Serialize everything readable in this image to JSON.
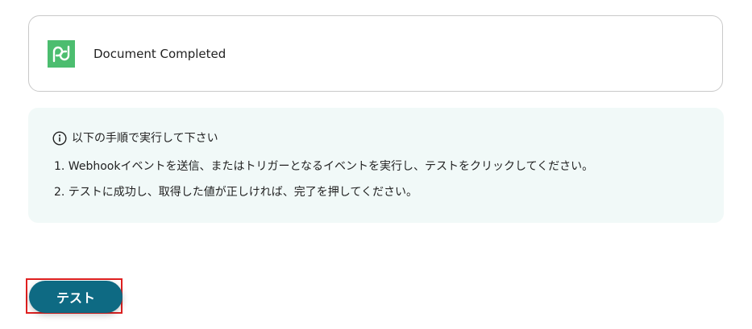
{
  "trigger": {
    "app_icon": "pandadoc-logo-icon",
    "event_name": "Document Completed"
  },
  "instructions": {
    "icon": "info-icon",
    "heading": "以下の手順で実行して下さい",
    "steps": [
      "1. Webhookイベントを送信、またはトリガーとなるイベントを実行し、テストをクリックしてください。",
      "2. テストに成功し、取得した値が正しければ、完了を押してください。"
    ]
  },
  "actions": {
    "test_label": "テスト"
  },
  "colors": {
    "brand_green": "#4cbd6f",
    "button_teal": "#0e6a83",
    "panel_bg": "#f1f9f8",
    "highlight_red": "#e02020"
  }
}
